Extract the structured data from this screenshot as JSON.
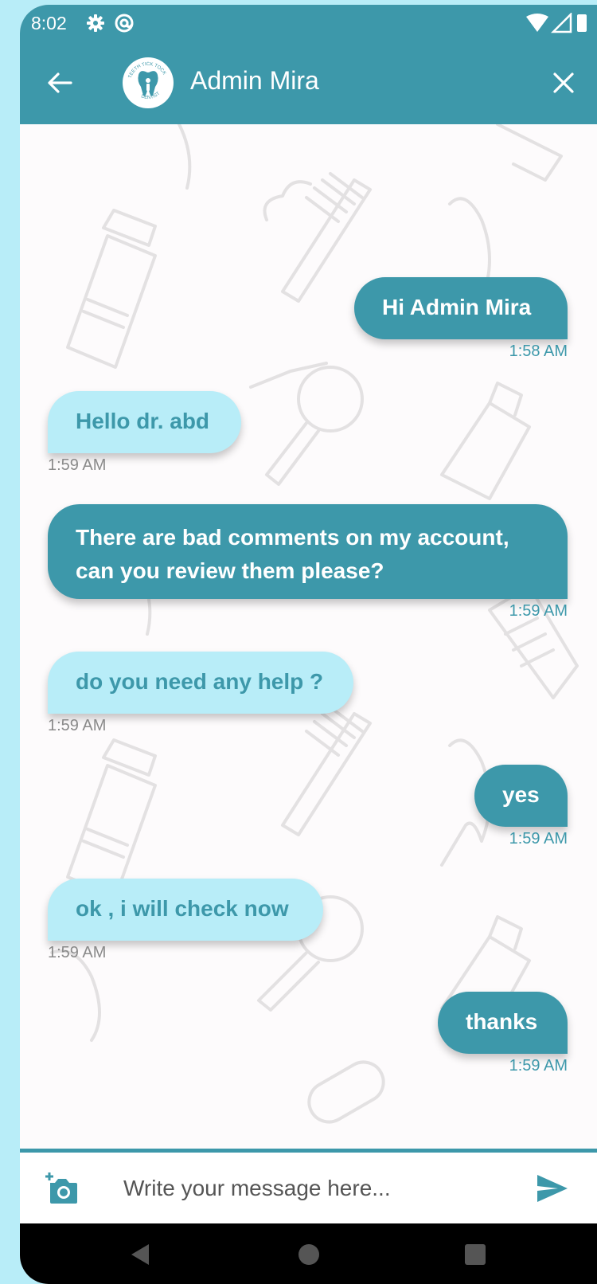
{
  "status_bar": {
    "time": "8:02",
    "icons": [
      "gear-icon",
      "at-sign-icon",
      "wifi-icon",
      "signal-icon",
      "battery-icon"
    ]
  },
  "header": {
    "title": "Admin Mira",
    "avatar_text_top": "TEETH TICK TOCK",
    "avatar_text_bottom": "DENTIST",
    "icons": [
      "arrow-left-icon",
      "close-icon"
    ]
  },
  "messages": [
    {
      "direction": "out",
      "text_lines": [
        "Hi Admin Mira"
      ],
      "time": "1:58 AM"
    },
    {
      "direction": "in",
      "text_lines": [
        "Hello dr. abd"
      ],
      "time": "1:59 AM"
    },
    {
      "direction": "out",
      "text_lines": [
        "There are bad comments on my account,",
        "can you review them please?"
      ],
      "time": "1:59 AM"
    },
    {
      "direction": "in",
      "text_lines": [
        "do you need any help ?"
      ],
      "time": "1:59 AM"
    },
    {
      "direction": "out",
      "text_lines": [
        "yes"
      ],
      "time": "1:59 AM"
    },
    {
      "direction": "in",
      "text_lines": [
        "ok , i will check now"
      ],
      "time": "1:59 AM"
    },
    {
      "direction": "out",
      "text_lines": [
        "thanks"
      ],
      "time": "1:59 AM"
    }
  ],
  "composer": {
    "placeholder": "Write your message here...",
    "icons": [
      "add-photo-camera-icon",
      "send-icon"
    ]
  },
  "colors": {
    "primary": "#3d98aa",
    "incoming_bubble": "#b8edf8",
    "chat_background": "#fdfbfc"
  }
}
